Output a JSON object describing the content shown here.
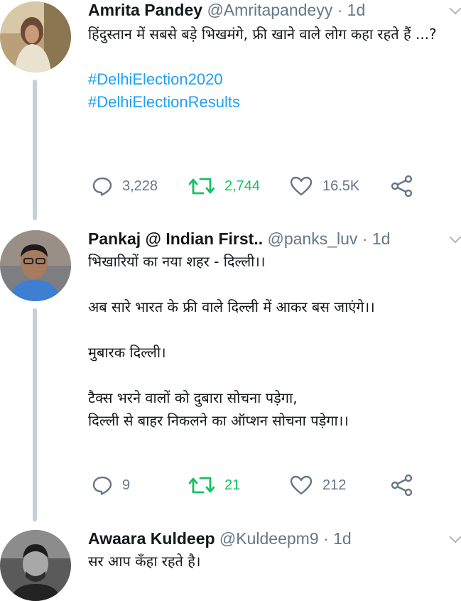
{
  "tweets": [
    {
      "name": "Amrita Pandey",
      "handle": "@Amritapandeyy",
      "time": "· 1d",
      "lines": [
        "हिंदुस्तान में सबसे बड़े भिखमंगे, फ्री खाने वाले लोग कहा रहते हैं ...?"
      ],
      "hashtags": [
        "#DelhiElection2020",
        "#DelhiElectionResults"
      ],
      "replies": "3,228",
      "retweets": "2,744",
      "likes": "16.5K"
    },
    {
      "name": "Pankaj @ Indian First..",
      "handle": "@panks_luv",
      "time": "· 1d",
      "lines": [
        "भिखारियों का नया शहर - दिल्ली।।",
        "",
        "अब सारे भारत के फ्री वाले दिल्ली में आकर बस जाएंगे।।",
        "",
        "मुबारक दिल्ली।",
        "",
        "टैक्स भरने वालों को दुबारा सोचना पड़ेगा,",
        "दिल्ली से बाहर निकलने का ऑप्शन सोचना पड़ेगा।।"
      ],
      "replies": "9",
      "retweets": "21",
      "likes": "212"
    },
    {
      "name": "Awaara Kuldeep",
      "handle": "@Kuldeepm9",
      "time": "· 1d",
      "lines": [
        "सर आप कँहा रहते है।"
      ]
    }
  ],
  "icons": {
    "reply": "reply-icon",
    "retweet": "retweet-icon",
    "like": "heart-icon",
    "share": "share-icon"
  },
  "colors": {
    "hashtag": "#1da1f2",
    "retweet_green": "#17bf63",
    "muted": "#657786",
    "thread_line": "#c4cfd6"
  }
}
